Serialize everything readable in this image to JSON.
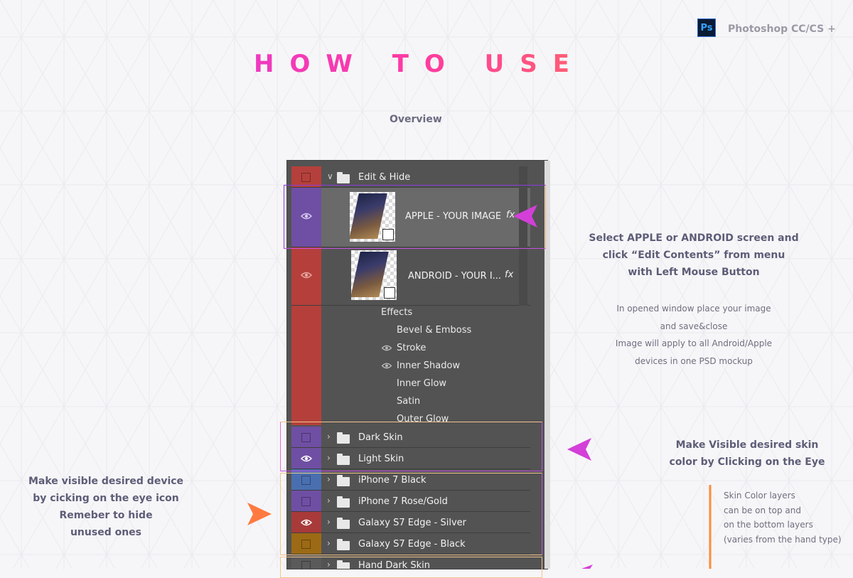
{
  "app": {
    "name": "Photoshop CC/CS +",
    "badge": "Ps"
  },
  "title": "HOW TO USE",
  "subtitle": "Overview",
  "layers_panel": {
    "group_edit": {
      "label": "Edit & Hide"
    },
    "apple_layer": {
      "label": "APPLE - YOUR IMAGE",
      "fx": "fx"
    },
    "android_layer": {
      "label": "ANDROID - YOUR I...",
      "fx": "fx"
    },
    "effects": {
      "header": "Effects",
      "items": [
        "Bevel & Emboss",
        "Stroke",
        "Inner Shadow",
        "Inner Glow",
        "Satin",
        "Outer Glow"
      ]
    },
    "rows": [
      {
        "label": "Dark Skin",
        "color": "#6f4fa3"
      },
      {
        "label": "Light Skin",
        "color": "#6f4fa3"
      },
      {
        "label": "iPhone 7 Black",
        "color": "#4a6fb0"
      },
      {
        "label": "iPhone 7 Rose/Gold",
        "color": "#6f4fa3"
      },
      {
        "label": "Galaxy S7 Edge - Silver",
        "color": "#a83a3a"
      },
      {
        "label": "Galaxy S7 Edge - Black",
        "color": "#9c6a14"
      },
      {
        "label": "Hand Dark Skin",
        "color": "#5a5a5a"
      }
    ],
    "colors": {
      "red": "#b5403b",
      "purple": "#6f4fa3"
    }
  },
  "callouts": {
    "select": {
      "lines": [
        "Select APPLE or ANDROID screen and",
        "click “Edit Contents” from menu",
        "with Left Mouse Button"
      ]
    },
    "instructions": {
      "lines": [
        "In opened window place your image",
        "and save&close",
        "Image will apply to all Android/Apple",
        "devices in one PSD mockup"
      ]
    },
    "skin": {
      "lines": [
        "Make Visible desired skin",
        "color by Clicking on the Eye"
      ]
    },
    "skin_note": {
      "lines": [
        "Skin Color layers",
        "can be on top and",
        "on the bottom layers",
        "(varies from the hand type)"
      ]
    },
    "device": {
      "lines": [
        "Make visible desired device",
        "by cicking on the eye icon",
        "Remeber to hide",
        "unused ones"
      ]
    }
  },
  "colors": {
    "accent_pink": "#e040d0",
    "accent_orange": "#ff8c3a",
    "title_gradient": [
      "#d63bf0",
      "#ff9a2a"
    ]
  }
}
